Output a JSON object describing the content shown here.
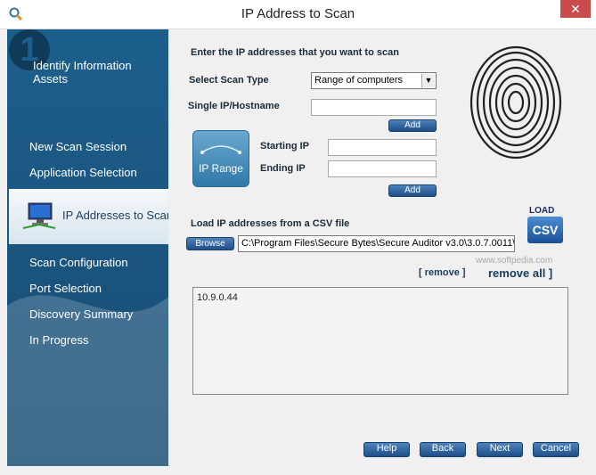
{
  "window": {
    "title": "IP Address to Scan",
    "close_label": "✕"
  },
  "sidebar": {
    "step_title": "Identify Information Assets",
    "items": [
      {
        "label": "New Scan Session"
      },
      {
        "label": "Application Selection"
      },
      {
        "label": "IP Addresses to Scan",
        "active": true
      },
      {
        "label": "Scan Configuration"
      },
      {
        "label": "Port Selection"
      },
      {
        "label": "Discovery Summary"
      },
      {
        "label": "In Progress"
      }
    ]
  },
  "main": {
    "heading": "Enter the IP addresses that you want to scan",
    "scan_type_label": "Select Scan Type",
    "scan_type_value": "Range of computers",
    "single_ip_label": "Single IP/Hostname",
    "single_ip_value": "",
    "add_label": "Add",
    "ip_range_badge": "IP Range",
    "starting_ip_label": "Starting IP",
    "starting_ip_value": "",
    "ending_ip_label": "Ending IP",
    "ending_ip_value": "",
    "csv_label": "Load IP addresses from a CSV file",
    "browse_label": "Browse",
    "csv_path": "C:\\Program Files\\Secure Bytes\\Secure Auditor v3.0\\3.0.7.0011\\",
    "load_csv_text": "LOAD",
    "load_csv_sub": "CSV",
    "remove_label": "[ remove ]",
    "remove_all_label": "remove all  ]",
    "ip_list": [
      "10.9.0.44"
    ]
  },
  "buttons": {
    "help": "Help",
    "back": "Back",
    "next": "Next",
    "cancel": "Cancel"
  },
  "watermark": "www.softpedia.com",
  "colors": {
    "sidebar": "#1b5680",
    "button": "#2a5c94",
    "close": "#c94c4c"
  }
}
